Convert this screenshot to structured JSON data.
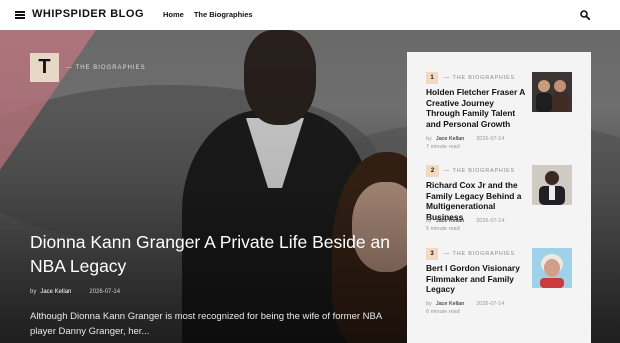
{
  "site": {
    "name": "WHIPSPIDER BLOG"
  },
  "nav": {
    "home": "Home",
    "biographies": "The Biographies"
  },
  "hero": {
    "badge": "T",
    "category": "— THE BIOGRAPHIES",
    "title": "Dionna Kann Granger A Private Life Beside an NBA Legacy",
    "by": "by",
    "author": "Jace Kellan",
    "date": "2026-07-14",
    "excerpt": "Although Dionna Kann Granger is most recognized for being the wife of former NBA player Danny Granger, her..."
  },
  "sidebar": {
    "items": [
      {
        "num": "1",
        "category": "— THE BIOGRAPHIES",
        "title": "Holden Fletcher Fraser A Creative Journey Through Family Talent and Personal Growth",
        "by": "by",
        "author": "Jace Kellan",
        "date": "2026-07-14",
        "read": "7 minute read"
      },
      {
        "num": "2",
        "category": "— THE BIOGRAPHIES",
        "title": "Richard Cox Jr and the Family Legacy Behind a Multigenerational Business",
        "by": "by",
        "author": "Jace Kellan",
        "date": "2026-07-14",
        "read": "5 minute read"
      },
      {
        "num": "3",
        "category": "— THE BIOGRAPHIES",
        "title": "Bert I Gordon Visionary Filmmaker and Family Legacy",
        "by": "by",
        "author": "Jace Kellan",
        "date": "2026-07-14",
        "read": "6 minute read"
      }
    ]
  }
}
